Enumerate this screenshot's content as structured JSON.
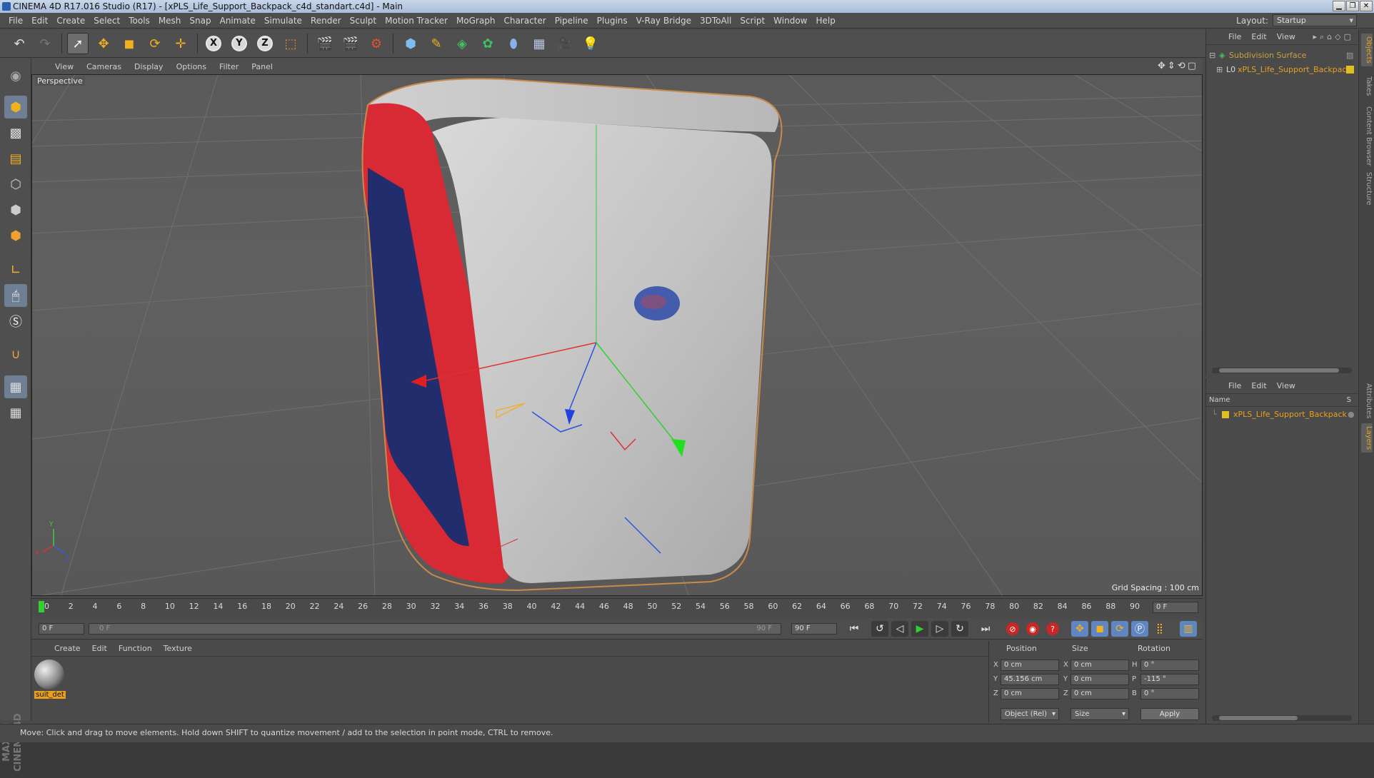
{
  "window": {
    "title": "CINEMA 4D R17.016 Studio (R17) - [xPLS_Life_Support_Backpack_c4d_standart.c4d] - Main",
    "controls": [
      "▁",
      "❐",
      "✕"
    ]
  },
  "menu": [
    "File",
    "Edit",
    "Create",
    "Select",
    "Tools",
    "Mesh",
    "Snap",
    "Animate",
    "Simulate",
    "Render",
    "Sculpt",
    "Motion Tracker",
    "MoGraph",
    "Character",
    "Pipeline",
    "Plugins",
    "V-Ray Bridge",
    "3DToAll",
    "Script",
    "Window",
    "Help"
  ],
  "layout": {
    "label": "Layout:",
    "value": "Startup"
  },
  "axes_buttons": [
    "X",
    "Y",
    "Z"
  ],
  "viewport": {
    "menu": [
      "View",
      "Cameras",
      "Display",
      "Options",
      "Filter",
      "Panel"
    ],
    "camera_label": "Perspective",
    "grid_spacing": "Grid Spacing : 100 cm",
    "axis_labels": {
      "y": "Y",
      "x": "X",
      "z": "Z"
    }
  },
  "timeline": {
    "ticks": [
      "0",
      "2",
      "4",
      "6",
      "8",
      "10",
      "12",
      "14",
      "16",
      "18",
      "20",
      "22",
      "24",
      "26",
      "28",
      "30",
      "32",
      "34",
      "36",
      "38",
      "40",
      "42",
      "44",
      "46",
      "48",
      "50",
      "52",
      "54",
      "56",
      "58",
      "60",
      "62",
      "64",
      "66",
      "68",
      "70",
      "72",
      "74",
      "76",
      "78",
      "80",
      "82",
      "84",
      "86",
      "88",
      "90"
    ],
    "current_frame_field": "0 F"
  },
  "transport": {
    "start_field": "0 F",
    "slider_start": "0 F",
    "slider_end": "90 F",
    "end_field": "90 F"
  },
  "material_manager": {
    "menu": [
      "Create",
      "Edit",
      "Function",
      "Texture"
    ],
    "materials": [
      {
        "name": "suit_det"
      }
    ]
  },
  "coordinates": {
    "headers": {
      "position": "Position",
      "size": "Size",
      "rotation": "Rotation"
    },
    "rows": [
      {
        "axis": "X",
        "pos": "0 cm",
        "size_axis": "X",
        "size": "0 cm",
        "rot_axis": "H",
        "rot": "0 °"
      },
      {
        "axis": "Y",
        "pos": "45.156 cm",
        "size_axis": "Y",
        "size": "0 cm",
        "rot_axis": "P",
        "rot": "-115 °"
      },
      {
        "axis": "Z",
        "pos": "0 cm",
        "size_axis": "Z",
        "size": "0 cm",
        "rot_axis": "B",
        "rot": "0 °"
      }
    ],
    "mode_dropdown": "Object (Rel)",
    "size_dropdown": "Size",
    "apply_label": "Apply"
  },
  "status": "Move: Click and drag to move elements. Hold down SHIFT to quantize movement / add to the selection in point mode, CTRL to remove.",
  "object_manager": {
    "menu": [
      "File",
      "Edit",
      "View"
    ],
    "items": [
      {
        "name": "Subdivision Surface",
        "color": "#c9a23a"
      },
      {
        "name": "xPLS_Life_Support_Backpack",
        "color": "#e8a020"
      }
    ]
  },
  "layer_manager": {
    "menu": [
      "File",
      "Edit",
      "View"
    ],
    "col_name": "Name",
    "col_s": "S",
    "items": [
      {
        "name": "xPLS_Life_Support_Backpack"
      }
    ]
  },
  "side_tabs": [
    "Objects",
    "Takes",
    "Content Browser",
    "Structure",
    "Attributes",
    "Layers"
  ],
  "colors": {
    "accent": "#e8a020",
    "active_tool": "#6e7f93",
    "play_green": "#2fd02f"
  }
}
